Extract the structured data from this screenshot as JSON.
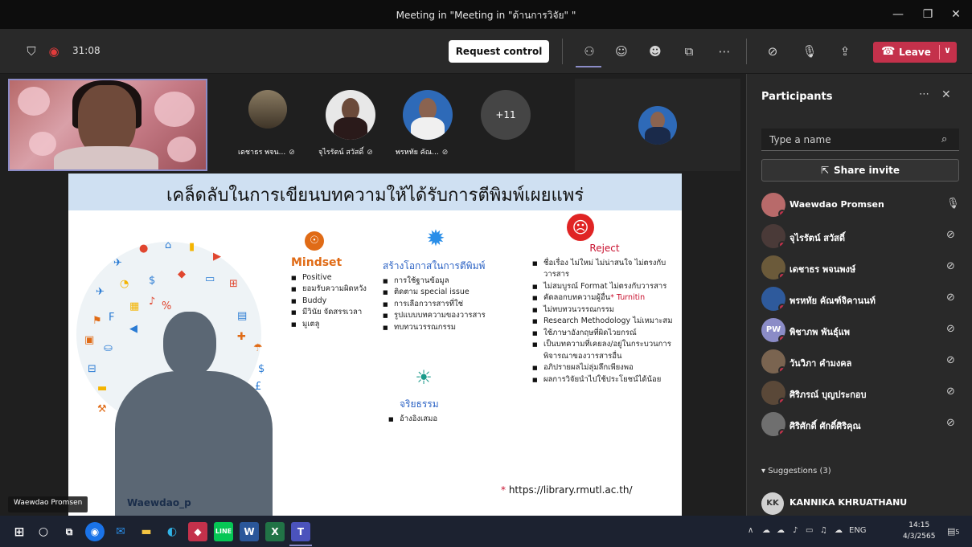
{
  "window": {
    "title": "Meeting in \"Meeting in \"ด้านการวิจัย\" \""
  },
  "toolbar": {
    "timer": "31:08",
    "request_control_label": "Request control",
    "leave_label": "Leave"
  },
  "stage": {
    "gallery": [
      {
        "name": "เดชาธร พจน...",
        "muted": true
      },
      {
        "name": "จุไรรัตน์ สวัสดิ์",
        "muted": true
      },
      {
        "name": "พรหทัย คัณ...",
        "muted": true
      }
    ],
    "more_count": "+11",
    "self_name_tag": "Waewdao Promsen"
  },
  "slide": {
    "title": "เคล็ดลับในการเขียนบทความให้ได้รับการตีพิมพ์เผยแพร่",
    "mindset": {
      "heading": "Mindset",
      "items": [
        "Positive",
        "ยอมรับความผิดหวัง",
        "Buddy",
        "มีวินัย จัดสรรเวลา",
        "มูเตลู"
      ]
    },
    "opportunity": {
      "heading": "สร้างโอกาสในการตีพิมพ์",
      "items": [
        "การใช้ฐานข้อมูล",
        "ติดตาม special issue",
        "การเลือกวารสารที่ใช่",
        "รูปแบบบทความของวารสาร",
        "ทบทวนวรรณกรรม"
      ]
    },
    "ethics": {
      "heading": "จริยธรรม",
      "items": [
        "อ้างอิงเสมอ"
      ]
    },
    "reject": {
      "heading": "Reject",
      "items": [
        "ชื่อเรื่อง ไม่ใหม่ ไม่น่าสนใจ ไม่ตรงกับวารสาร",
        "ไม่สมบูรณ์ Format ไม่ตรงกับวารสาร",
        "คัดลอกบทความผู้อื่น",
        "ไม่ทบทวนวรรณกรรม",
        "Research Methodology ไม่เหมาะสม",
        "ใช้ภาษาอังกฤษที่ผิดไวยกรณ์",
        "เป็นบทความที่เคยลง/อยู่ในกระบวนการพิจารณาของวารสารอื่น",
        "อภิปรายผลไม่ลุ่มลึกเพียงพอ",
        "ผลการวิจัยนำไปใช้ประโยชน์ได้น้อย"
      ],
      "turnitin_note": "* Turnitin"
    },
    "presenter": "Waewdao_p",
    "source_url": "https://library.rmutl.ac.th/",
    "source_mark": "*"
  },
  "participants": {
    "title": "Participants",
    "search_placeholder": "Type a name",
    "share_invite_label": "Share invite",
    "list": [
      {
        "name": "Waewdao Promsen",
        "mic": "on",
        "color": "#b86a6a"
      },
      {
        "name": "จุไรรัตน์ สวัสดิ์",
        "mic": "off",
        "color": "#4a3a38"
      },
      {
        "name": "เดชาธร พจนพงษ์",
        "mic": "off",
        "color": "#6b5a3a"
      },
      {
        "name": "พรหทัย คัณฑ์จิคานนท์",
        "mic": "off",
        "color": "#2e5a9c"
      },
      {
        "name": "พิชาภพ พันธุ์แพ",
        "mic": "off",
        "initials": "PW",
        "color": "#8b8cc7"
      },
      {
        "name": "วันวิภา คำมงคล",
        "mic": "off",
        "color": "#7a6450"
      },
      {
        "name": "ศิริภรณ์ บุญประกอบ",
        "mic": "off",
        "color": "#5a4838"
      },
      {
        "name": "ศิริศักดิ์ ศักดิ์ศิริคุณ",
        "mic": "off",
        "color": "#6f6f6f"
      }
    ],
    "suggestions_label": "Suggestions (3)",
    "suggestion": {
      "initials": "KK",
      "name": "KANNIKA KHRUATHANU"
    }
  },
  "taskbar": {
    "language": "ENG",
    "time": "14:15",
    "date": "4/3/2565",
    "notification_count": "5"
  }
}
